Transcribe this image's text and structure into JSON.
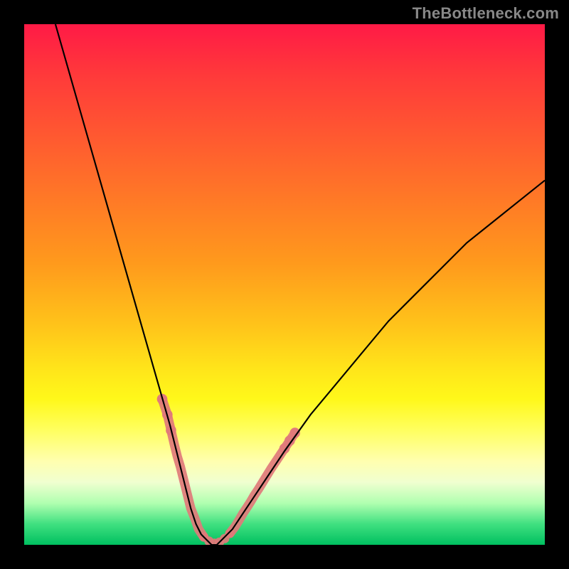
{
  "watermark": "TheBottleneck.com",
  "colors": {
    "curve": "#000000",
    "markers": "#e07a7a",
    "frame": "#000000"
  },
  "chart_data": {
    "type": "line",
    "title": "",
    "xlabel": "",
    "ylabel": "",
    "xlim": [
      0,
      100
    ],
    "ylim": [
      0,
      100
    ],
    "grid": false,
    "series": [
      {
        "name": "bottleneck-curve",
        "x": [
          6,
          8,
          10,
          12,
          14,
          16,
          18,
          20,
          22,
          24,
          26,
          28,
          29,
          30,
          31,
          32,
          33,
          34,
          35,
          36,
          37,
          38,
          40,
          42,
          44,
          46,
          50,
          55,
          60,
          65,
          70,
          75,
          80,
          85,
          90,
          95,
          100
        ],
        "y": [
          100,
          93,
          86,
          79,
          72,
          65,
          58,
          51,
          44,
          37,
          30,
          23,
          19,
          15,
          11,
          7,
          4,
          2,
          1,
          0,
          0,
          1,
          3,
          6,
          9,
          12,
          18,
          25,
          31,
          37,
          43,
          48,
          53,
          58,
          62,
          66,
          70
        ]
      }
    ],
    "markers": {
      "name": "highlighted-points",
      "points": [
        {
          "x": 26.5,
          "y": 28
        },
        {
          "x": 27.5,
          "y": 25
        },
        {
          "x": 28.2,
          "y": 22
        },
        {
          "x": 28.9,
          "y": 19
        },
        {
          "x": 29.4,
          "y": 17
        },
        {
          "x": 30.0,
          "y": 15
        },
        {
          "x": 30.5,
          "y": 13
        },
        {
          "x": 31.0,
          "y": 11
        },
        {
          "x": 31.5,
          "y": 9
        },
        {
          "x": 32.0,
          "y": 7
        },
        {
          "x": 32.8,
          "y": 5
        },
        {
          "x": 33.5,
          "y": 3
        },
        {
          "x": 34.5,
          "y": 1.5
        },
        {
          "x": 35.5,
          "y": 0.7
        },
        {
          "x": 36.5,
          "y": 0.3
        },
        {
          "x": 37.5,
          "y": 0.5
        },
        {
          "x": 38.5,
          "y": 1.2
        },
        {
          "x": 39.5,
          "y": 2.2
        },
        {
          "x": 40.5,
          "y": 3.5
        },
        {
          "x": 41.3,
          "y": 4.8
        },
        {
          "x": 42.0,
          "y": 6.0
        },
        {
          "x": 42.8,
          "y": 7.2
        },
        {
          "x": 43.5,
          "y": 8.3
        },
        {
          "x": 44.2,
          "y": 9.5
        },
        {
          "x": 45.0,
          "y": 10.7
        },
        {
          "x": 45.8,
          "y": 12.0
        },
        {
          "x": 46.6,
          "y": 13.3
        },
        {
          "x": 47.4,
          "y": 14.6
        },
        {
          "x": 48.2,
          "y": 15.8
        },
        {
          "x": 49.0,
          "y": 17.0
        },
        {
          "x": 50.0,
          "y": 18.5
        },
        {
          "x": 51.0,
          "y": 20.0
        },
        {
          "x": 52.0,
          "y": 21.5
        }
      ]
    }
  }
}
